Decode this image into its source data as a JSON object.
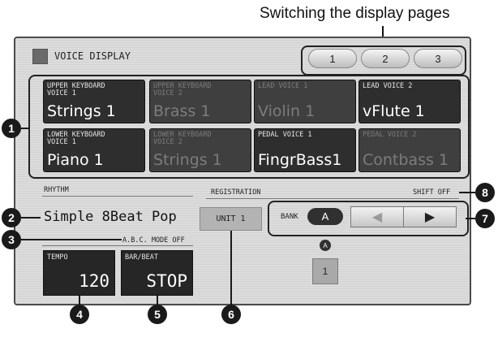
{
  "caption": "Switching the display pages",
  "window": {
    "title": "VOICE DISPLAY"
  },
  "pages": [
    "1",
    "2",
    "3"
  ],
  "voices": [
    {
      "label": "UPPER KEYBOARD\nVOICE 1",
      "name": "Strings 1",
      "active": true
    },
    {
      "label": "UPPER KEYBOARD\nVOICE 2",
      "name": "Brass 1",
      "active": false
    },
    {
      "label": "LEAD VOICE 1",
      "name": "Violin 1",
      "active": false
    },
    {
      "label": "LEAD VOICE 2",
      "name": "vFlute 1",
      "active": true
    },
    {
      "label": "LOWER KEYBOARD\nVOICE 1",
      "name": "Piano 1",
      "active": true
    },
    {
      "label": "LOWER KEYBOARD\nVOICE 2",
      "name": "Strings 1",
      "active": false
    },
    {
      "label": "PEDAL VOICE 1",
      "name": "FingrBass1",
      "active": true
    },
    {
      "label": "PEDAL VOICE 2",
      "name": "Contbass 1",
      "active": false
    }
  ],
  "rhythm": {
    "section_label": "RHYTHM",
    "name": "Simple 8Beat Pop",
    "abc_mode": "A.B.C. MODE OFF",
    "tempo_label": "TEMPO",
    "tempo_value": "120",
    "barbeat_label": "BAR/BEAT",
    "barbeat_value": "STOP"
  },
  "registration": {
    "section_label": "REGISTRATION",
    "shift": "SHIFT OFF",
    "unit_button": "UNIT 1",
    "bank_label": "BANK",
    "bank_value": "A",
    "prev_icon": "◀",
    "next_icon": "▶",
    "memory_bank_letter": "A",
    "memory_number": "1"
  },
  "callouts": [
    "1",
    "2",
    "3",
    "4",
    "5",
    "6",
    "7",
    "8"
  ],
  "colors": {
    "panel": "#d6d6d6",
    "voice_active": "#2e2e2e",
    "voice_dim": "#3f3f3f",
    "callout": "#1a1a1a"
  }
}
